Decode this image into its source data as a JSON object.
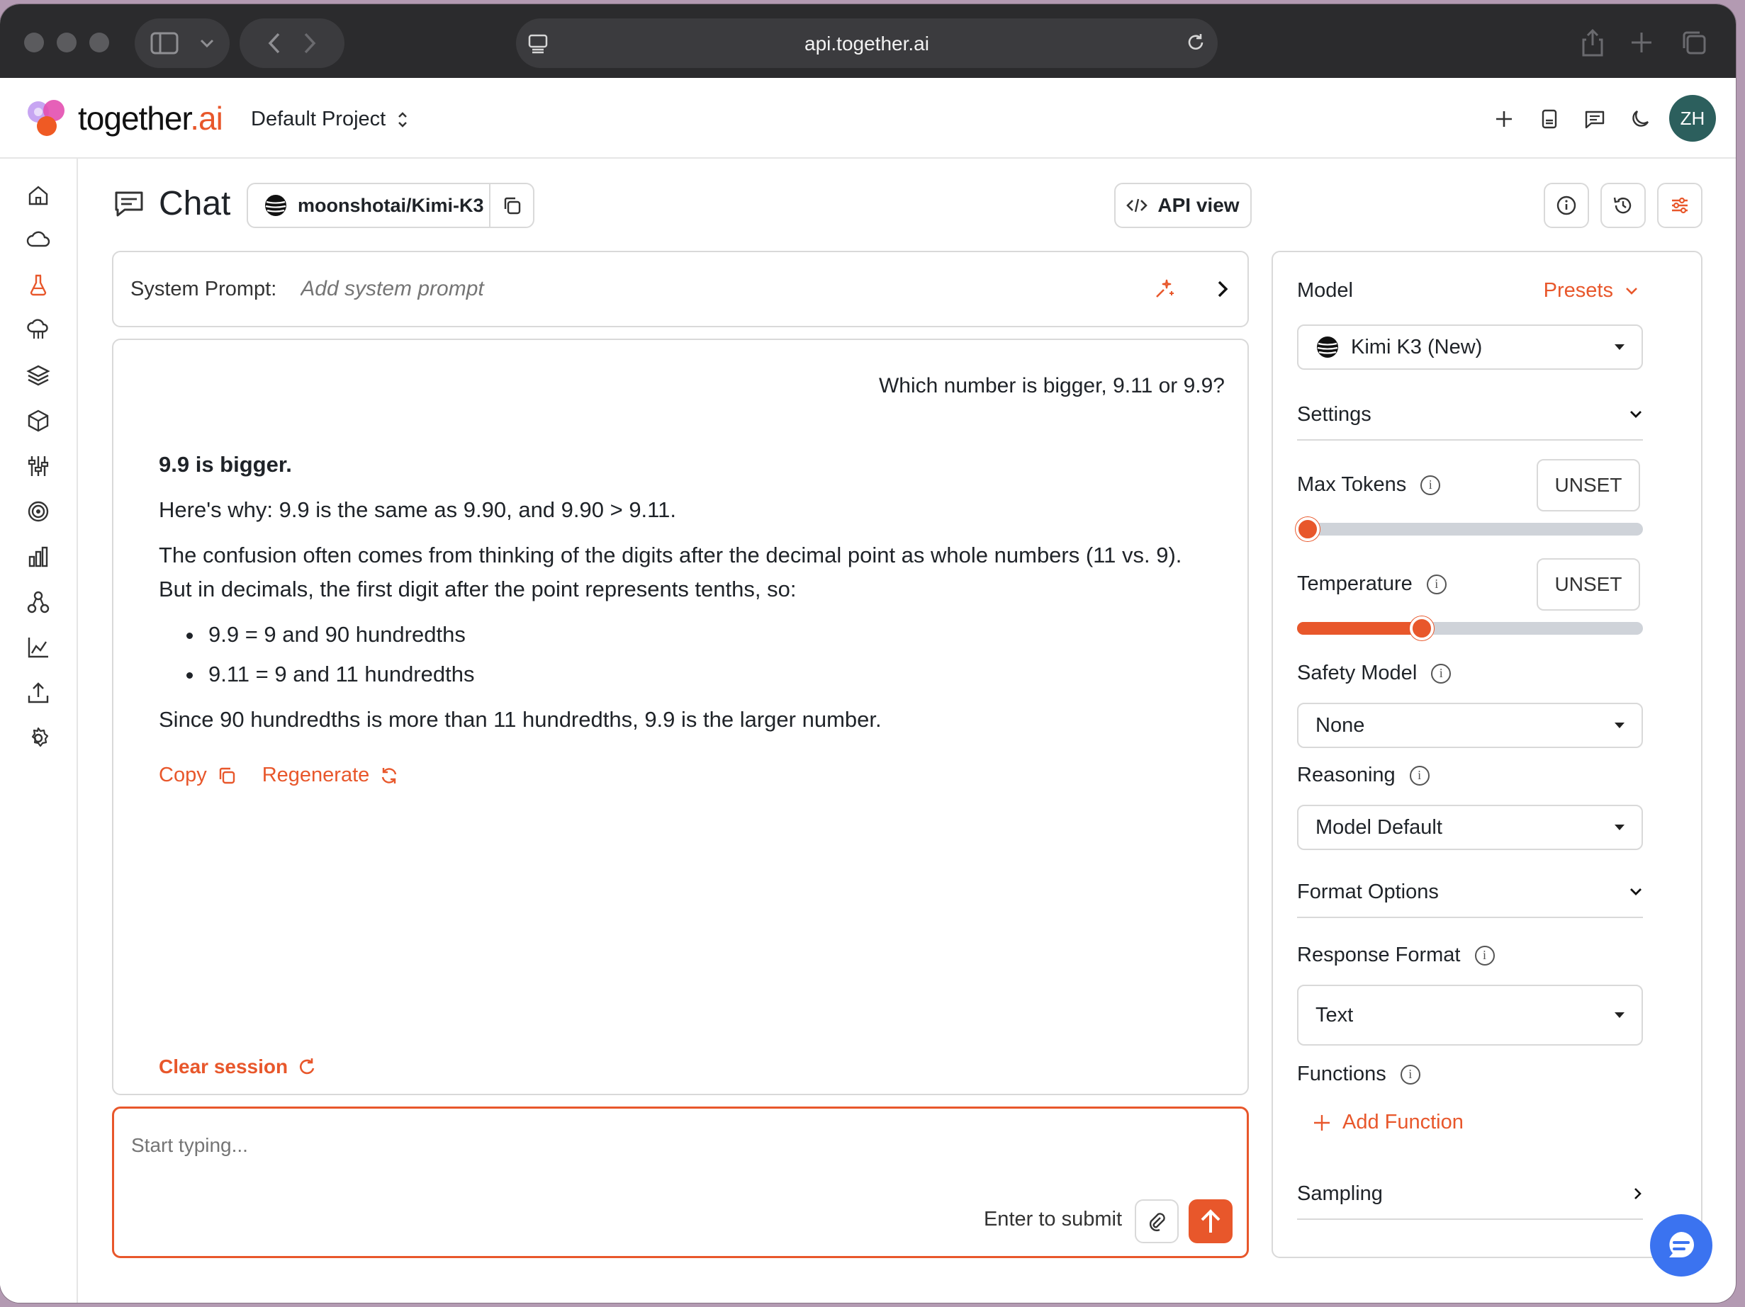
{
  "browser": {
    "url": "api.together.ai"
  },
  "header": {
    "logo_text_main": "together",
    "logo_text_dot": ".ai",
    "project": "Default Project",
    "avatar_initials": "ZH"
  },
  "chat": {
    "title": "Chat",
    "model_chip": "moonshotai/Kimi-K3",
    "api_view_label": "API view",
    "system_prompt_label": "System Prompt:",
    "system_prompt_placeholder": "Add system prompt",
    "user_message": "Which number is bigger, 9.11 or 9.9?",
    "answer": {
      "headline": "9.9 is bigger.",
      "p1": "Here's why: 9.9 is the same as 9.90, and 9.90 > 9.11.",
      "p2_line1": "The confusion often comes from thinking of the digits after the decimal point as whole numbers (11 vs. 9).",
      "p2_line2": "But in decimals, the first digit after the point represents tenths, so:",
      "bullets": [
        "9.9 = 9 and 90 hundredths",
        "9.11 = 9 and 11 hundredths"
      ],
      "p3": "Since 90 hundredths is more than 11 hundredths, 9.9 is the larger number."
    },
    "copy_label": "Copy",
    "regenerate_label": "Regenerate",
    "clear_session_label": "Clear session",
    "composer_placeholder": "Start typing...",
    "enter_hint": "Enter to submit"
  },
  "panel": {
    "model_label": "Model",
    "presets_label": "Presets",
    "model_select": "Kimi K3 (New)",
    "settings_label": "Settings",
    "max_tokens_label": "Max Tokens",
    "max_tokens_value": "UNSET",
    "max_tokens_slider_fraction": 0.03,
    "temperature_label": "Temperature",
    "temperature_value": "UNSET",
    "temperature_slider_fraction": 0.36,
    "safety_model_label": "Safety Model",
    "safety_model_value": "None",
    "reasoning_label": "Reasoning",
    "reasoning_value": "Model Default",
    "format_options_label": "Format Options",
    "response_format_label": "Response Format",
    "response_format_value": "Text",
    "functions_label": "Functions",
    "add_function_label": "Add Function",
    "sampling_label": "Sampling"
  },
  "colors": {
    "accent": "#e8572b",
    "avatar_bg": "#2c5f5d",
    "help_bubble": "#3b73f0"
  }
}
